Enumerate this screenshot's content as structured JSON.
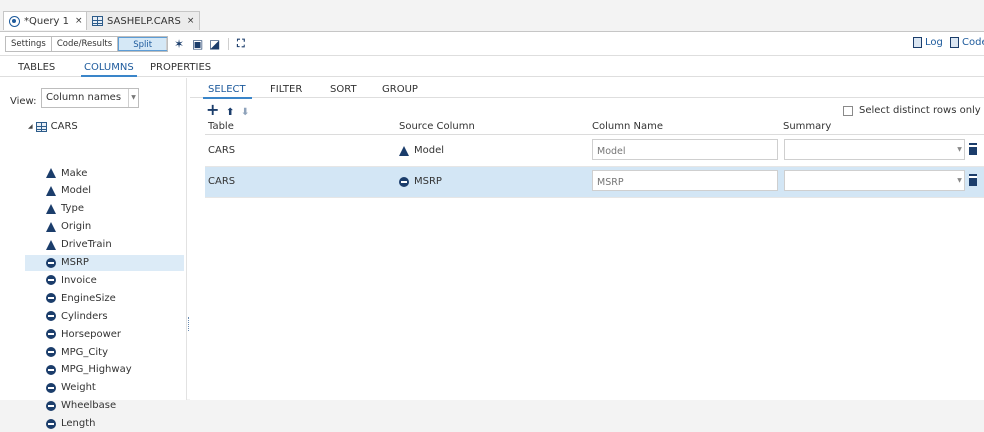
{
  "doc_tabs": [
    {
      "label": "*Query 1",
      "close": "×"
    },
    {
      "label": "SASHELP.CARS",
      "close": "×"
    }
  ],
  "toolbar": {
    "settings": "Settings",
    "code_results": "Code/Results",
    "split": "Split",
    "run_icon": "run-icon",
    "save_icon": "save-icon",
    "save_as_icon": "save-as-icon",
    "maximize_icon": "maximize-icon",
    "log": "Log",
    "code": "Code"
  },
  "main_tabs": [
    "TABLES",
    "COLUMNS",
    "PROPERTIES"
  ],
  "left_panel": {
    "view_label": "View:",
    "view_value": "Column names",
    "root": "CARS",
    "columns": [
      {
        "name": "Make",
        "type": "char"
      },
      {
        "name": "Model",
        "type": "char"
      },
      {
        "name": "Type",
        "type": "char"
      },
      {
        "name": "Origin",
        "type": "char"
      },
      {
        "name": "DriveTrain",
        "type": "char"
      },
      {
        "name": "MSRP",
        "type": "num"
      },
      {
        "name": "Invoice",
        "type": "num"
      },
      {
        "name": "EngineSize",
        "type": "num"
      },
      {
        "name": "Cylinders",
        "type": "num"
      },
      {
        "name": "Horsepower",
        "type": "num"
      },
      {
        "name": "MPG_City",
        "type": "num"
      },
      {
        "name": "MPG_Highway",
        "type": "num"
      },
      {
        "name": "Weight",
        "type": "num"
      },
      {
        "name": "Wheelbase",
        "type": "num"
      },
      {
        "name": "Length",
        "type": "num"
      }
    ],
    "selected": "MSRP"
  },
  "right_panel": {
    "tabs": [
      "SELECT",
      "FILTER",
      "SORT",
      "GROUP"
    ],
    "actions": {
      "add": "+",
      "up": "⬆",
      "down": "⬇"
    },
    "distinct_label": "Select distinct rows only",
    "headers": [
      "Table",
      "Source Column",
      "Column Name",
      "Summary"
    ],
    "rows": [
      {
        "table": "CARS",
        "source": "Model",
        "type": "char",
        "column_name": "Model",
        "summary": ""
      },
      {
        "table": "CARS",
        "source": "MSRP",
        "type": "num",
        "column_name": "MSRP",
        "summary": ""
      }
    ]
  },
  "colors": {
    "accent": "#1d5a9c",
    "selection": "#d3e6f5",
    "icon": "#1b3d6b"
  }
}
